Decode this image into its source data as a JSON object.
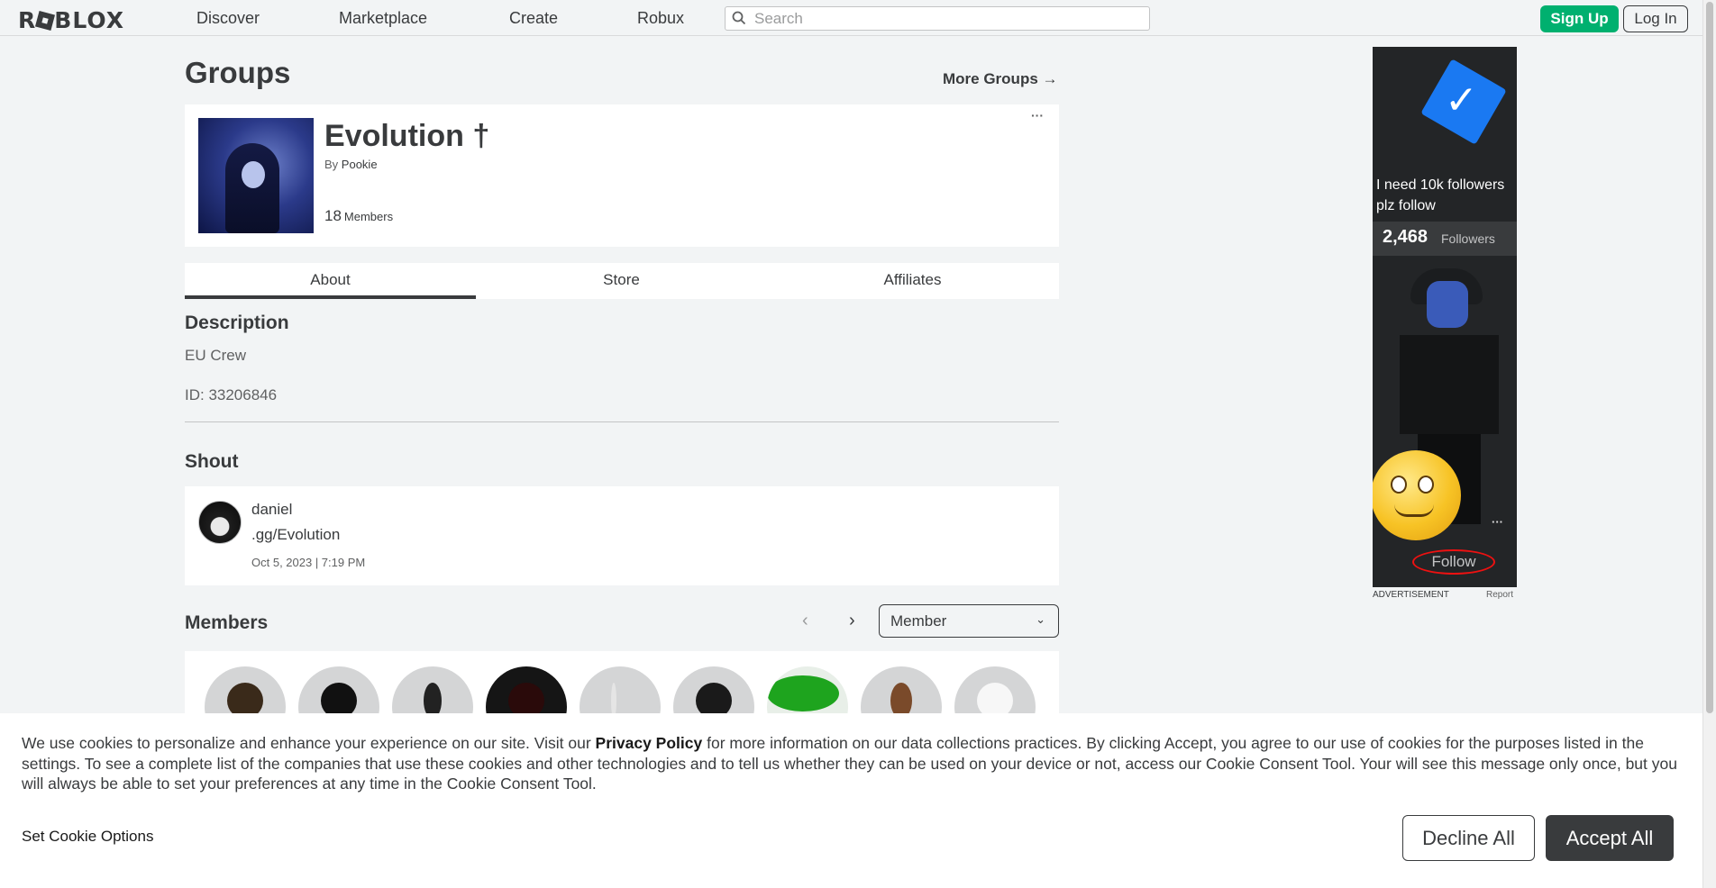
{
  "nav": {
    "logo": "ROBLOX",
    "links": [
      "Discover",
      "Marketplace",
      "Create",
      "Robux"
    ],
    "search_placeholder": "Search",
    "signup_label": "Sign Up",
    "login_label": "Log In"
  },
  "page": {
    "title": "Groups",
    "more_groups": "More Groups →"
  },
  "group": {
    "name": "Evolution †",
    "by_label": "By",
    "owner": "Pookie",
    "member_count": "18",
    "members_label": "Members"
  },
  "tabs": [
    "About",
    "Store",
    "Affiliates"
  ],
  "about": {
    "description_title": "Description",
    "description": "EU Crew",
    "id_text": "ID: 33206846"
  },
  "shout": {
    "title": "Shout",
    "user": "daniel",
    "message": ".gg/Evolution",
    "date": "Oct 5, 2023 | 7:19 PM"
  },
  "members": {
    "title": "Members",
    "role_selected": "Member"
  },
  "ad": {
    "text": "I need 10k followers plz follow",
    "followers_count": "2,468",
    "followers_label": "Followers",
    "follow_label": "Follow",
    "advertisement_label": "ADVERTISEMENT",
    "report_label": "Report"
  },
  "cookie": {
    "text_before": "We use cookies to personalize and enhance your experience on our site. Visit our ",
    "policy_link": "Privacy Policy",
    "text_after": " for more information on our data collections practices. By clicking Accept, you agree to our use of cookies for the purposes listed in the settings. To see a complete list of the companies that use these cookies and other technologies and to tell us whether they can be used on your device or not, access our Cookie Consent Tool. Your will see this message only once, but you will always be able to set your preferences at any time in the Cookie Consent Tool.",
    "set_options": "Set Cookie Options",
    "decline": "Decline All",
    "accept": "Accept All"
  },
  "colors": {
    "signup_green": "#00b06f",
    "accept_dark": "#393b3d",
    "background": "#f2f4f5"
  }
}
